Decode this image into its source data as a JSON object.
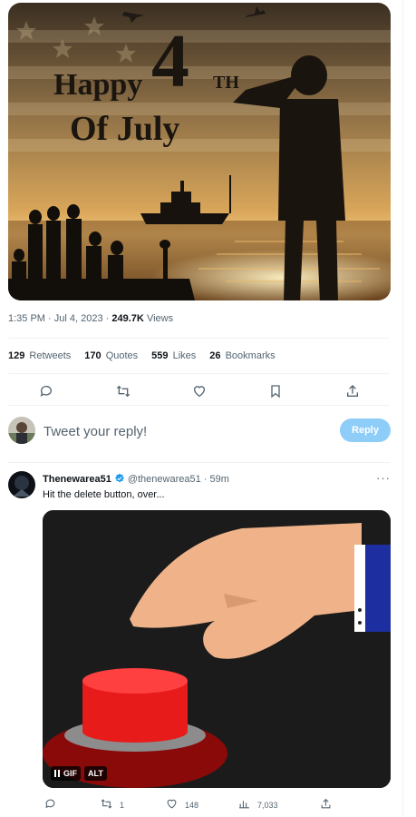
{
  "main_image": {
    "title_line1": "Happy",
    "title_number": "4",
    "title_suffix": "TH",
    "title_line2": "Of July"
  },
  "meta": {
    "time": "1:35 PM",
    "separator": "·",
    "date": "Jul 4, 2023",
    "views_count": "249.7K",
    "views_label": "Views"
  },
  "stats": {
    "retweets": {
      "count": "129",
      "label": "Retweets"
    },
    "quotes": {
      "count": "170",
      "label": "Quotes"
    },
    "likes": {
      "count": "559",
      "label": "Likes"
    },
    "bookmarks": {
      "count": "26",
      "label": "Bookmarks"
    }
  },
  "icons": [
    "reply-icon",
    "retweet-icon",
    "like-icon",
    "bookmark-icon",
    "share-icon",
    "verified-icon",
    "more-icon",
    "views-icon",
    "pause-icon"
  ],
  "reply": {
    "placeholder": "Tweet your reply!",
    "button_label": "Reply"
  },
  "reply_tweet": {
    "name": "Thenewarea51",
    "handle": "@thenewarea51",
    "separator": "·",
    "time": "59m",
    "more": "···",
    "text": "Hit the delete button, over...",
    "gif_badge": "GIF",
    "alt_badge": "ALT",
    "retweet_count": "1",
    "like_count": "148",
    "views_count": "7,033"
  },
  "colors": {
    "accent": "#1d9bf0",
    "reply_button_disabled": "#8ecdf8",
    "muted_text": "#536471"
  }
}
